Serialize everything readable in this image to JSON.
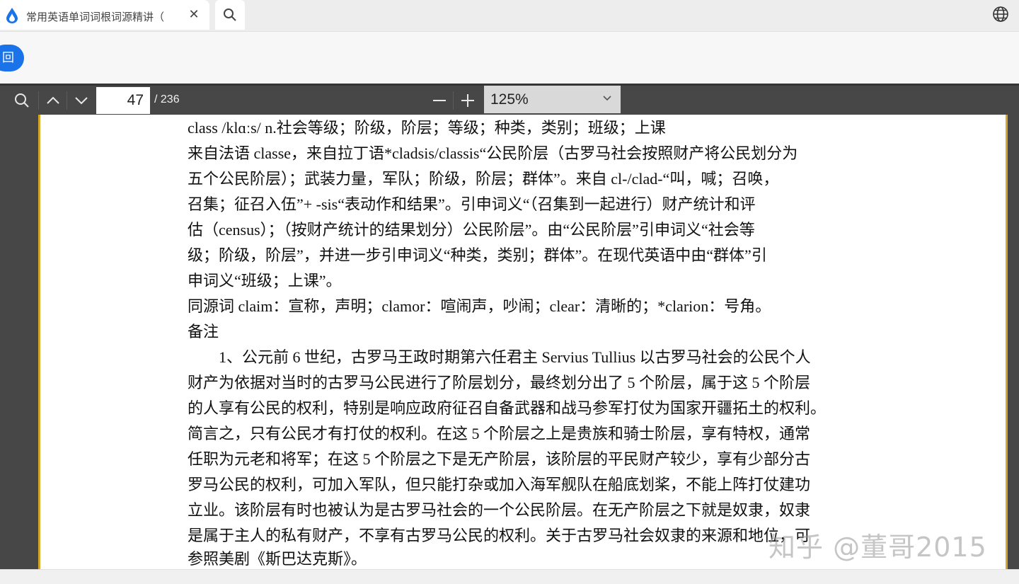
{
  "tab": {
    "title": "常用英语单词词根词源精讲（",
    "close_glyph": "✕"
  },
  "back_button": {
    "label": "回"
  },
  "pdf_toolbar": {
    "current_page": "47",
    "total_pages": "/ 236",
    "zoom_value": "125%",
    "zoom_out_glyph": "—",
    "zoom_in_glyph": "+"
  },
  "document": {
    "lines": [
      "class /klɑːs/ n.社会等级；阶级，阶层；等级；种类，类别；班级；上课",
      "来自法语 classe，来自拉丁语*cladsis/classis“公民阶层（古罗马社会按照财产将公民划分为",
      "五个公民阶层）；武装力量，军队；阶级，阶层；群体”。来自 cl-/clad-“叫，喊；召唤，",
      "召集；征召入伍”+ -sis“表动作和结果”。引申词义“（召集到一起进行）财产统计和评",
      "估（census）；（按财产统计的结果划分）公民阶层”。由“公民阶层”引申词义“社会等",
      "级；阶级，阶层”，并进一步引申词义“种类，类别；群体”。在现代英语中由“群体”引",
      "申词义“班级；上课”。",
      "同源词 claim：宣称，声明；clamor：喧闹声，吵闹；clear：清晰的；*clarion：号角。",
      "备注",
      "　　1、公元前 6 世纪，古罗马王政时期第六任君主 Servius Tullius 以古罗马社会的公民个人",
      "财产为依据对当时的古罗马公民进行了阶层划分，最终划分出了 5 个阶层，属于这 5 个阶层",
      "的人享有公民的权利，特别是响应政府征召自备武器和战马参军打仗为国家开疆拓土的权利。",
      "简言之，只有公民才有打仗的权利。在这 5 个阶层之上是贵族和骑士阶层，享有特权，通常",
      "任职为元老和将军；在这 5 个阶层之下是无产阶层，该阶层的平民财产较少，享有少部分古",
      "罗马公民的权利，可加入军队，但只能打杂或加入海军舰队在船底划桨，不能上阵打仗建功",
      "立业。该阶层有时也被认为是古罗马社会的一个公民阶层。在无产阶层之下就是奴隶，奴隶",
      "是属于主人的私有财产，不享有古罗马公民的权利。关于古罗马社会奴隶的来源和地位，可",
      "参照美剧《斯巴达克斯》。"
    ]
  },
  "watermark": {
    "text": "知乎 @董哥2015"
  },
  "colors": {
    "accent": "#1a73e8",
    "toolbar": "#474747",
    "page_border": "#d4a72c"
  }
}
